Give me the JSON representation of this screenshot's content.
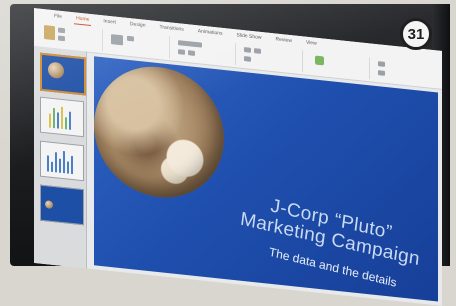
{
  "ribbon": {
    "tabs": [
      "File",
      "Home",
      "Insert",
      "Design",
      "Transitions",
      "Animations",
      "Slide Show",
      "Review",
      "View"
    ],
    "active_tab": "Home"
  },
  "thumbnails": [
    {
      "label": "slide-1"
    },
    {
      "label": "slide-2"
    },
    {
      "label": "slide-3"
    },
    {
      "label": "slide-4"
    }
  ],
  "slide": {
    "title_line1": "J-Corp “Pluto”",
    "title_line2": "Marketing Campaign",
    "subtitle": "The data and the details"
  },
  "page_badge": "31",
  "colors": {
    "slide_blue": "#1f4fae",
    "selected_thumb_border": "#d08a2c",
    "accent": "#c04a1b"
  }
}
